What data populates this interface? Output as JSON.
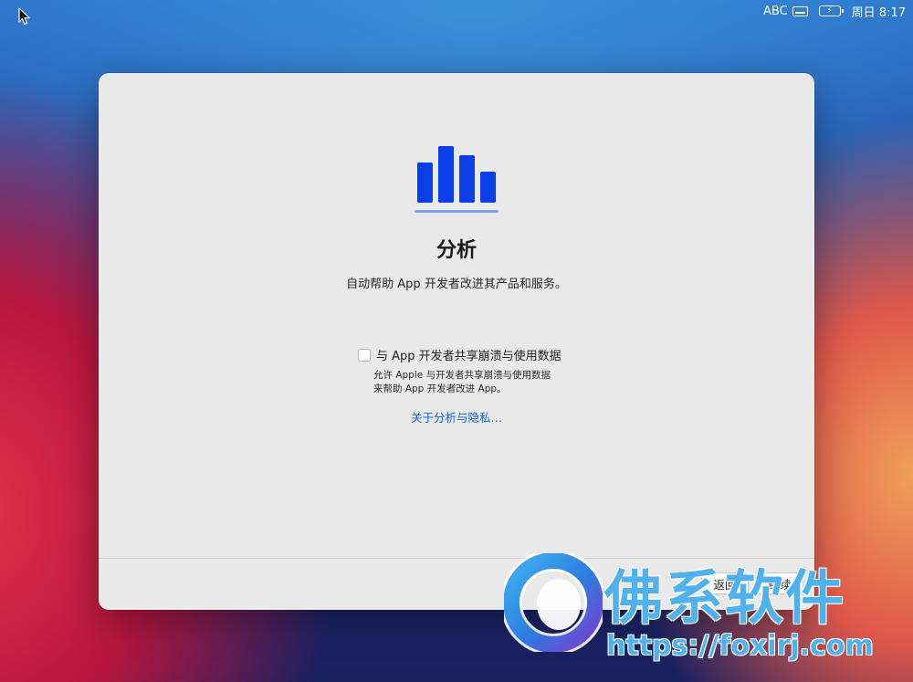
{
  "menubar": {
    "input_source": "ABC",
    "clock": "周日 8:17",
    "icons": [
      "cursor-arrow",
      "keyboard-icon",
      "battery-charging-icon"
    ]
  },
  "dialog": {
    "title": "分析",
    "subtitle": "自动帮助 App 开发者改进其产品和服务。",
    "hero_icon": "analytics-bar-chart-icon",
    "option": {
      "label": "与 App 开发者共享崩溃与使用数据",
      "checked": false,
      "description_line1": "允许 Apple 与开发者共享崩溃与使用数据",
      "description_line2": "来帮助 App 开发者改进 App。"
    },
    "link_text": "关于分析与隐私…",
    "back_label": "返回",
    "continue_label": "继续"
  },
  "colors": {
    "accent": "#1565d8",
    "hero_bars": "#0a3ee8",
    "hero_underline": "#7ea0f0",
    "window_bg": "#e9e9e9"
  },
  "watermark": {
    "name": "佛系软件",
    "url": "https://foxirj.com"
  }
}
